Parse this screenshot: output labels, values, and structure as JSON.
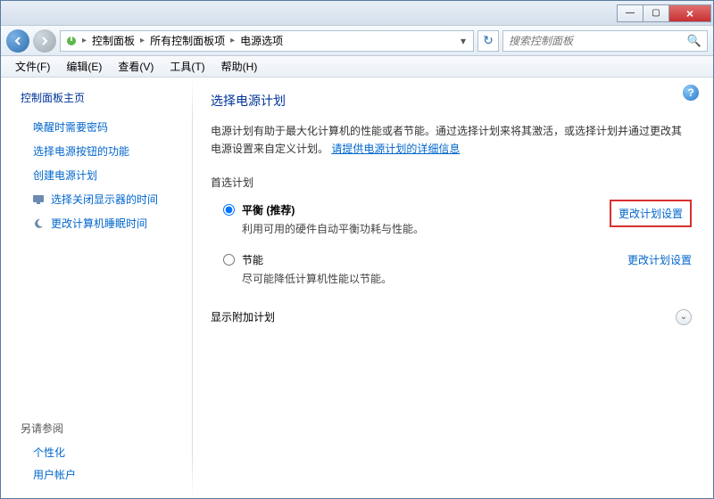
{
  "titlebar": {
    "min": "—",
    "max": "▢",
    "close": "×"
  },
  "nav": {
    "breadcrumb": [
      "控制面板",
      "所有控制面板项",
      "电源选项"
    ],
    "search_placeholder": "搜索控制面板"
  },
  "menubar": [
    "文件(F)",
    "编辑(E)",
    "查看(V)",
    "工具(T)",
    "帮助(H)"
  ],
  "sidebar": {
    "title": "控制面板主页",
    "links": [
      "唤醒时需要密码",
      "选择电源按钮的功能",
      "创建电源计划"
    ],
    "icon_links": [
      "选择关闭显示器的时间",
      "更改计算机睡眠时间"
    ],
    "footer_title": "另请参阅",
    "footer_links": [
      "个性化",
      "用户帐户"
    ]
  },
  "main": {
    "heading": "选择电源计划",
    "desc_part1": "电源计划有助于最大化计算机的性能或者节能。通过选择计划来将其激活，或选择计划并通过更改其电源设置来自定义计划。",
    "desc_link": "请提供电源计划的详细信息",
    "section_label": "首选计划",
    "plans": [
      {
        "name": "平衡 (推荐)",
        "desc": "利用可用的硬件自动平衡功耗与性能。",
        "link": "更改计划设置",
        "checked": true,
        "highlighted": true
      },
      {
        "name": "节能",
        "desc": "尽可能降低计算机性能以节能。",
        "link": "更改计划设置",
        "checked": false,
        "highlighted": false
      }
    ],
    "expander_label": "显示附加计划"
  }
}
